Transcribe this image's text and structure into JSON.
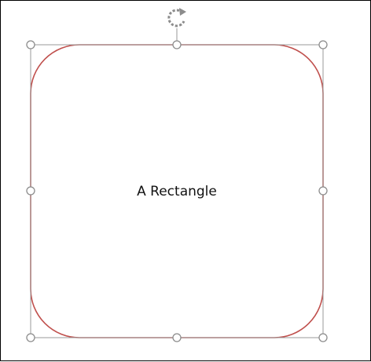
{
  "shape": {
    "label": "A Rectangle",
    "kind": "rounded-rectangle",
    "outline_color": "#c0504d",
    "fill_color": "#ffffff"
  },
  "selection": {
    "frame_color": "#9a9a9a",
    "handle_color": "#8c8c8c",
    "rotate_icon": "rotate-handle-icon"
  }
}
